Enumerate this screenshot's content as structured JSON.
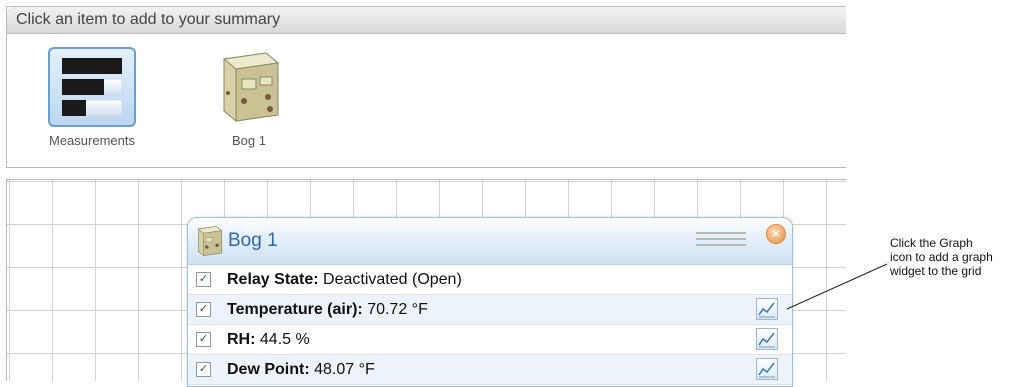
{
  "top_panel": {
    "header_text": "Click an item to add to your summary",
    "tiles": [
      {
        "label": "Measurements",
        "icon": "measurements-bars-icon",
        "selected": true
      },
      {
        "label": "Bog 1",
        "icon": "device-enclosure-icon",
        "selected": false
      }
    ]
  },
  "widget": {
    "title": "Bog 1",
    "icon": "device-enclosure-icon",
    "rows": [
      {
        "label": "Relay State:",
        "value": "Deactivated (Open)",
        "checked": true,
        "has_graph": false
      },
      {
        "label": "Temperature (air):",
        "value": "70.72 °F",
        "checked": true,
        "has_graph": true
      },
      {
        "label": "RH:",
        "value": "44.5 %",
        "checked": true,
        "has_graph": true
      },
      {
        "label": "Dew Point:",
        "value": "48.07 °F",
        "checked": true,
        "has_graph": true
      }
    ]
  },
  "annotation": {
    "line1": "Click the Graph",
    "line2": "icon to add a graph",
    "line3": "widget to the grid"
  },
  "colors": {
    "widget_title": "#2d6aa8",
    "selected_tile_border": "#6a9fd3",
    "close_button": "#f0a060"
  }
}
